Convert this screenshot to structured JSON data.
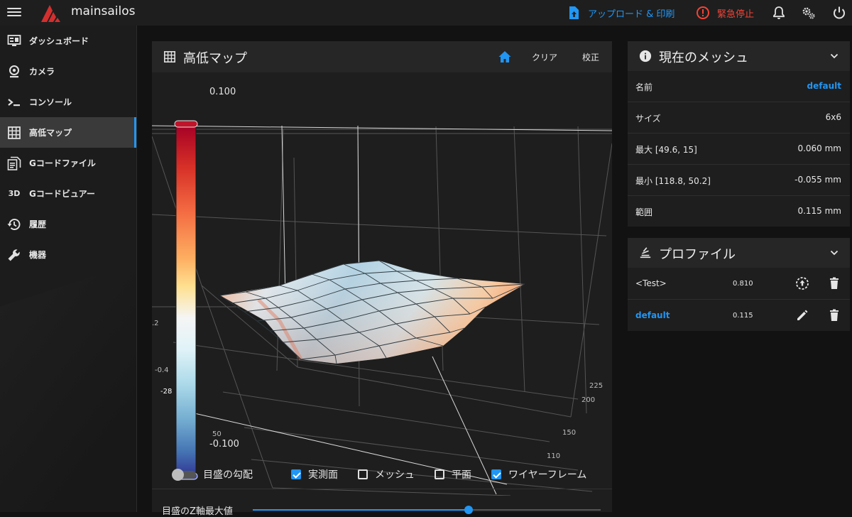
{
  "topbar": {
    "brand": "mainsailos",
    "upload_label": "アップロード & 印刷",
    "estop_label": "緊急停止"
  },
  "sidebar": {
    "items": [
      {
        "label": "ダッシュボード",
        "icon": "monitor-dashboard-icon",
        "active": false
      },
      {
        "label": "カメラ",
        "icon": "webcam-icon",
        "active": false
      },
      {
        "label": "コンソール",
        "icon": "console-icon",
        "active": false
      },
      {
        "label": "高低マップ",
        "icon": "grid-icon",
        "active": true
      },
      {
        "label": "Gコードファイル",
        "icon": "file-document-icon",
        "active": false
      },
      {
        "label": "Gコードビュアー",
        "icon": "3d-icon",
        "active": false
      },
      {
        "label": "履歴",
        "icon": "history-icon",
        "active": false
      },
      {
        "label": "機器",
        "icon": "wrench-icon",
        "active": false
      }
    ],
    "icon_3d_text": "3D"
  },
  "heightmap": {
    "title": "高低マップ",
    "clear_label": "クリア",
    "calibrate_label": "校正",
    "colorbar_max": "0.100",
    "colorbar_min": "-0.100",
    "axis_ticks": {
      "z_02": ".2",
      "z_04": "-0.4",
      "z_n28": "-28",
      "x_50": "50",
      "y_225": "225",
      "y_200": "200",
      "y_150": "150",
      "y_110": "110"
    },
    "options": {
      "scale_gradient": "目盛の勾配",
      "probed": "実測面",
      "mesh": "メッシュ",
      "flat": "平面",
      "wireframe": "ワイヤーフレーム"
    },
    "scale_gradient_on": false,
    "probed_on": true,
    "mesh_on": false,
    "flat_on": false,
    "wireframe_on": true,
    "slider_label": "目盛のZ軸最大値",
    "slider_fraction": 0.62
  },
  "current_mesh": {
    "title": "現在のメッシュ",
    "rows": [
      {
        "k": "名前",
        "v": "default"
      },
      {
        "k": "サイズ",
        "v": "6x6"
      },
      {
        "k": "最大 [49.6, 15]",
        "v": "0.060 mm"
      },
      {
        "k": "最小 [118.8, 50.2]",
        "v": "-0.055 mm"
      },
      {
        "k": "範囲",
        "v": "0.115 mm"
      }
    ]
  },
  "profiles": {
    "title": "プロファイル",
    "items": [
      {
        "name": "<Test>",
        "value": "0.810"
      },
      {
        "name": "default",
        "value": "0.115"
      }
    ]
  },
  "colors": {
    "accent": "#2196f3",
    "danger": "#f44336"
  }
}
